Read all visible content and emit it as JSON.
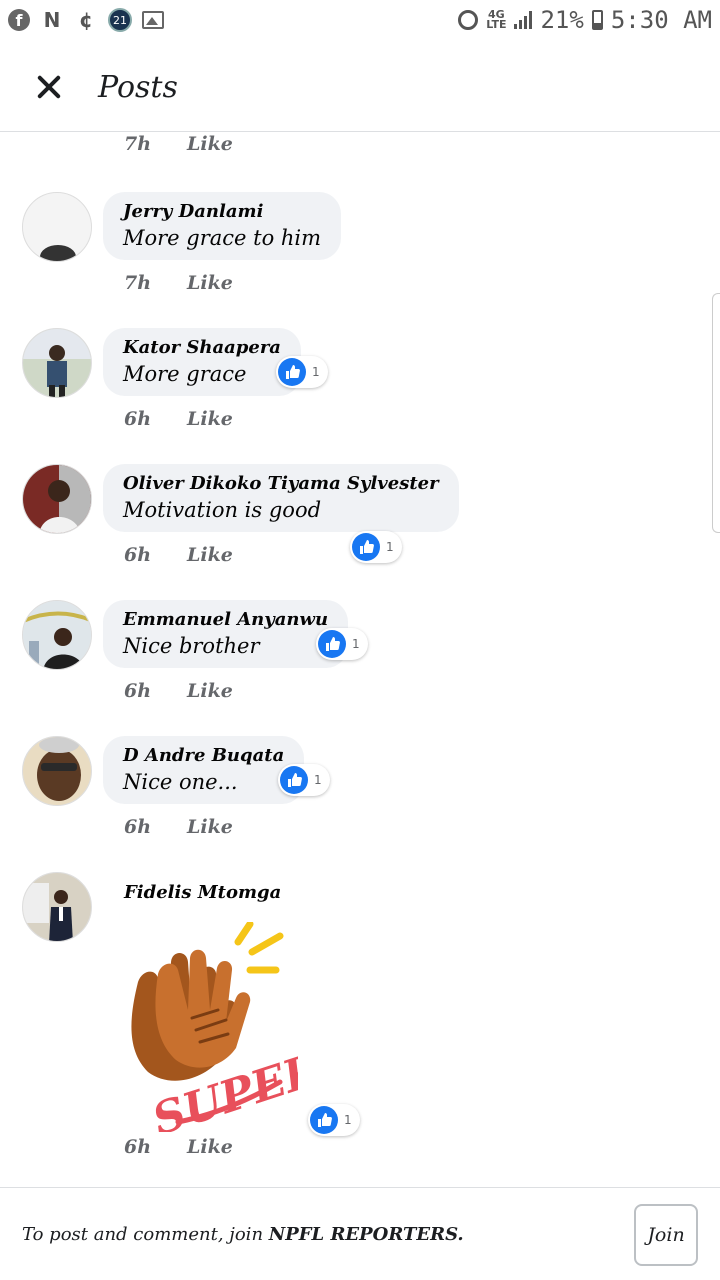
{
  "status_bar": {
    "badge_count": "21",
    "network": "4G LTE",
    "battery": "21%",
    "time": "5:30 AM"
  },
  "header": {
    "title": "Posts"
  },
  "top_meta": {
    "time": "7h",
    "like": "Like"
  },
  "comments": [
    {
      "name": "Jerry Danlami",
      "text": "More grace to him",
      "time": "7h",
      "like": "Like",
      "reactions": ""
    },
    {
      "name": "Kator Shaapera",
      "text": "More grace",
      "time": "6h",
      "like": "Like",
      "reactions": "1"
    },
    {
      "name": "Oliver Dikoko Tiyama Sylvester",
      "text": "Motivation is good",
      "time": "6h",
      "like": "Like",
      "reactions": "1"
    },
    {
      "name": "Emmanuel Anyanwu",
      "text": "Nice brother",
      "time": "6h",
      "like": "Like",
      "reactions": "1"
    },
    {
      "name": "D Andre Buqata",
      "text": "Nice one...",
      "time": "6h",
      "like": "Like",
      "reactions": "1"
    },
    {
      "name": "Fidelis Mtomga",
      "sticker_text": "SUPER!",
      "time": "6h",
      "like": "Like",
      "reactions": "1"
    }
  ],
  "footer": {
    "prefix": "To post and comment, join",
    "group": "NPFL REPORTERS.",
    "join_label": "Join"
  },
  "colors": {
    "accent": "#1877f2",
    "bubble": "#f0f2f5",
    "muted": "#65676b"
  }
}
